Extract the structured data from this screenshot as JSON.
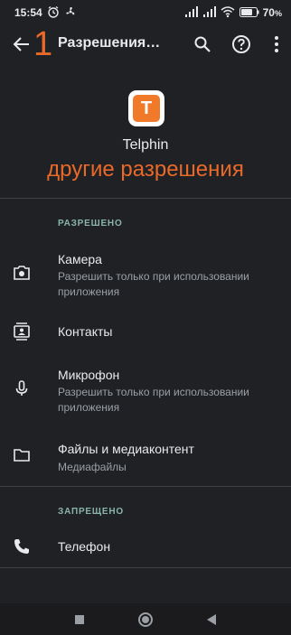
{
  "status_bar": {
    "time": "15:54",
    "battery": "70"
  },
  "app_bar": {
    "overlay_number": "1",
    "title": "Разрешения…"
  },
  "app": {
    "icon_letter": "T",
    "name": "Telphin",
    "overlay_subtitle": "другие разрешения"
  },
  "sections": {
    "allowed_label": "РАЗРЕШЕНО",
    "denied_label": "ЗАПРЕЩЕНО"
  },
  "permissions": [
    {
      "title": "Камера",
      "subtitle": "Разрешить только при использовании приложения",
      "icon": "camera-icon"
    },
    {
      "title": "Контакты",
      "subtitle": "",
      "icon": "contacts-icon"
    },
    {
      "title": "Микрофон",
      "subtitle": "Разрешить только при использовании приложения",
      "icon": "microphone-icon"
    },
    {
      "title": "Файлы и медиаконтент",
      "subtitle": "Медиафайлы",
      "icon": "folder-icon"
    },
    {
      "title": "Телефон",
      "subtitle": "",
      "icon": "phone-icon"
    }
  ],
  "colors": {
    "background": "#202124",
    "accent_overlay": "#e8692a",
    "section_label": "#8ab4a8",
    "app_icon": "#f07a2a"
  }
}
